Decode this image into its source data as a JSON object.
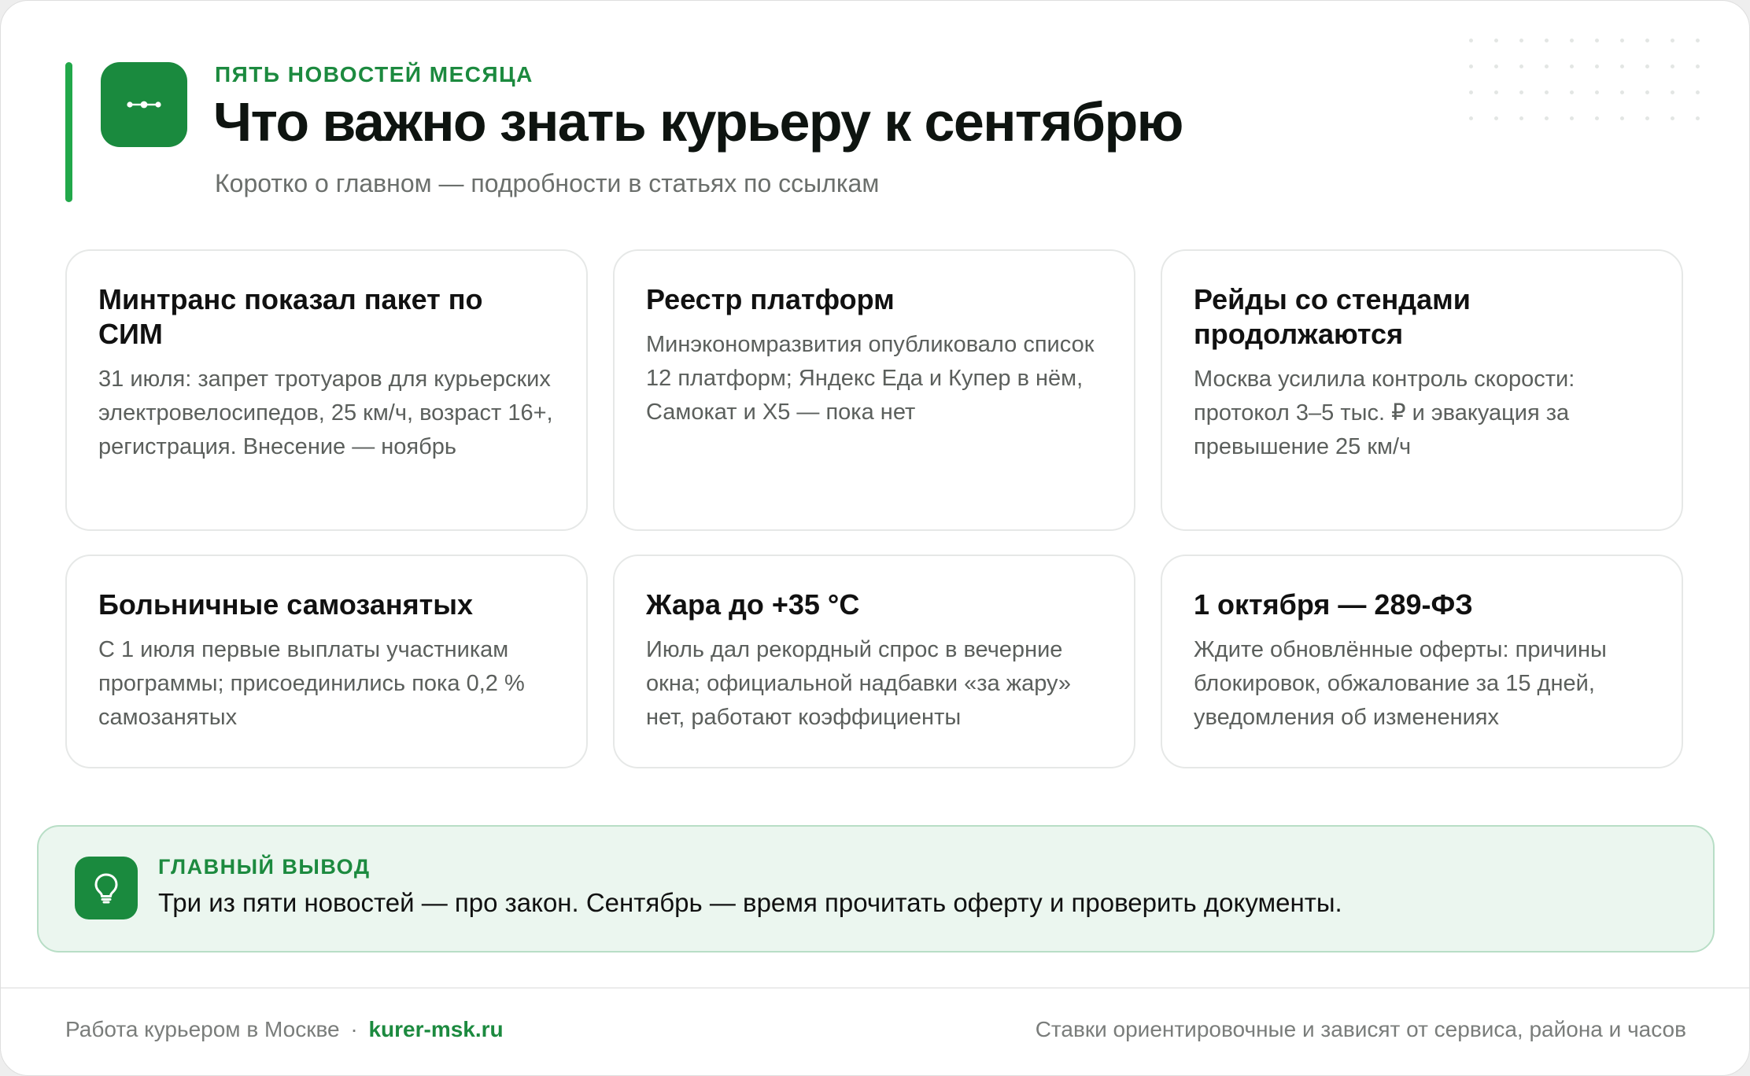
{
  "header": {
    "eyebrow": "ПЯТЬ НОВОСТЕЙ МЕСЯЦА",
    "title": "Что важно знать курьеру к сентябрю",
    "subtitle": "Коротко о главном — подробности в статьях по ссылкам",
    "logo_icon": "route-dots-icon"
  },
  "cards": [
    {
      "title": "Минтранс показал пакет по СИМ",
      "text": "31 июля: запрет тротуаров для курьерских электровелосипедов, 25 км/ч, возраст 16+, регистрация. Внесение — ноябрь"
    },
    {
      "title": "Реестр платформ",
      "text": "Минэкономразвития опубликовало список 12 платформ; Яндекс Еда и Купер в нём, Самокат и X5 — пока нет"
    },
    {
      "title": "Рейды со стендами продолжаются",
      "text": "Москва усилила контроль скорости: протокол 3–5 тыс. ₽ и эвакуация за превышение 25 км/ч"
    },
    {
      "title": "Больничные самозанятых",
      "text": "С 1 июля первые выплаты участникам программы; присоединились пока 0,2 % самозанятых"
    },
    {
      "title": "Жара до +35 °C",
      "text": "Июль дал рекордный спрос в вечерние окна; официальной надбавки «за жару» нет, работают коэффициенты"
    },
    {
      "title": "1 октября — 289-ФЗ",
      "text": "Ждите обновлённые оферты: причины блокировок, обжалование за 15 дней, уведомления об изменениях"
    }
  ],
  "takeaway": {
    "label": "ГЛАВНЫЙ ВЫВОД",
    "text": "Три из пяти новостей — про закон. Сентябрь — время прочитать оферту и проверить документы.",
    "icon": "lightbulb-icon"
  },
  "footer": {
    "left_text": "Работа курьером в Москве",
    "separator": "·",
    "site": "kurer-msk.ru",
    "right_text": "Ставки ориентировочные и зависят от сервиса, района и часов"
  },
  "colors": {
    "accent": "#1a8a3e",
    "accent_text": "#1c8a3f",
    "takeaway_bg": "#ebf6ef"
  }
}
